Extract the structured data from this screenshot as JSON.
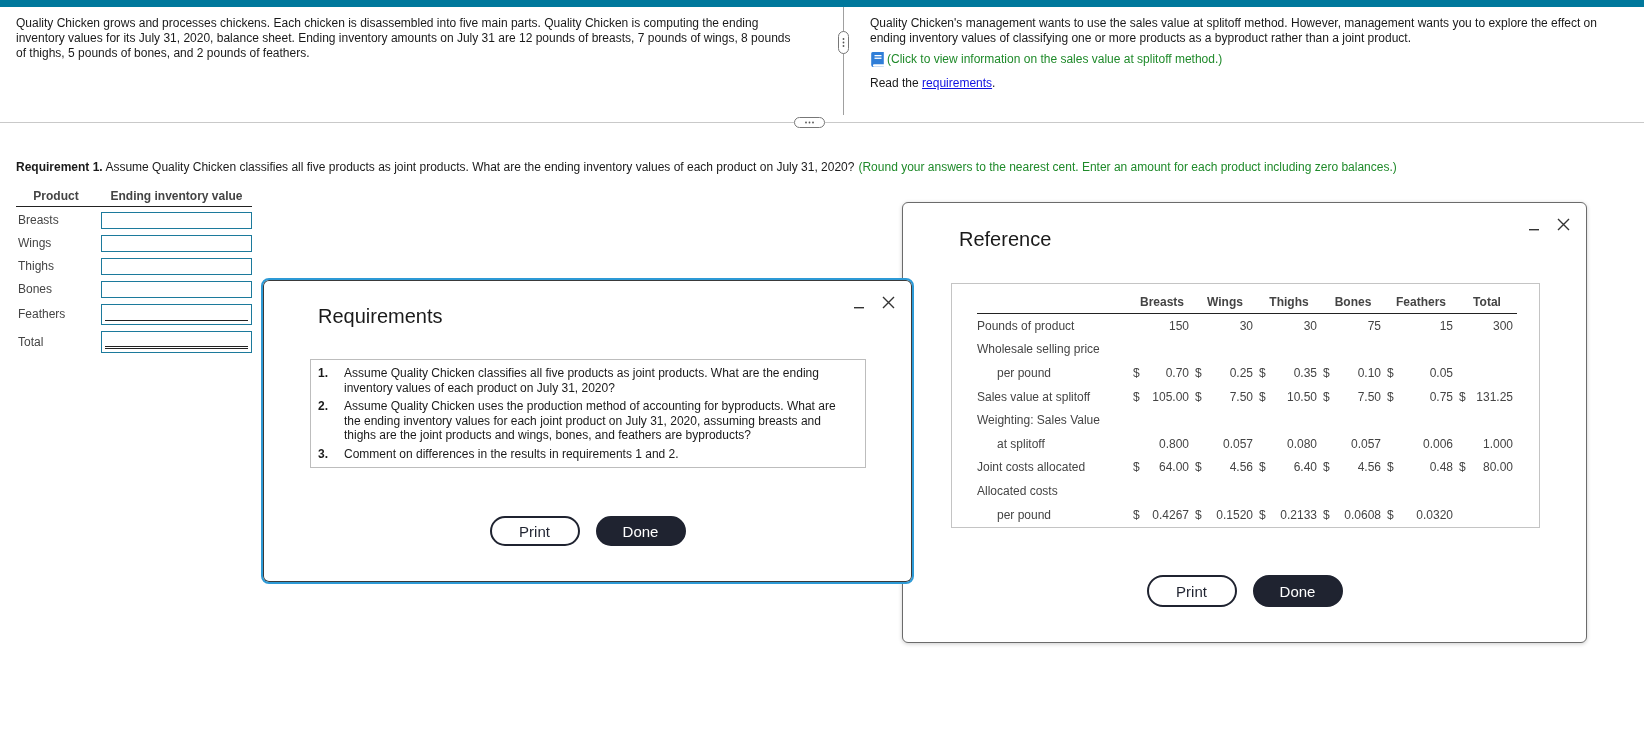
{
  "problem": {
    "text": "Quality Chicken grows and processes chickens. Each chicken is disassembled into five main parts. Quality Chicken is computing the ending inventory values for its July 31, 2020, balance sheet. Ending inventory amounts on July 31 are 12 pounds of breasts, 7 pounds of wings, 8 pounds of thighs, 5 pounds of bones, and 2 pounds of feathers."
  },
  "info": {
    "text": "Quality Chicken's management wants to use the sales value at splitoff method. However, management wants you to explore the effect on ending inventory values of classifying one or more products as a byproduct rather than a joint product.",
    "reference_link": "(Click to view information on the sales value at splitoff method.)",
    "read_before": "Read the",
    "read_link": "requirements",
    "read_after": "."
  },
  "question": {
    "text": "**Requirement 1.** Assume Quality Chicken classifies all five products as joint products. What are the ending inventory values of each product on July 31, 2020?",
    "hint": "(Round your answers to the nearest cent. Enter an amount for each product including zero balances.)"
  },
  "answer_table": {
    "columns": [
      "Product",
      "Ending inventory value"
    ],
    "rows": [
      {
        "label": "Breasts",
        "kind": "entry"
      },
      {
        "label": "Wings",
        "kind": "entry"
      },
      {
        "label": "Thighs",
        "kind": "entry"
      },
      {
        "label": "Bones",
        "kind": "entry"
      },
      {
        "label": "Feathers",
        "kind": "subtotal"
      },
      {
        "label": "Total",
        "kind": "total"
      }
    ]
  },
  "requirements_dialog": {
    "title": "Requirements",
    "focused": true,
    "items": [
      {
        "number": "1.",
        "text": "Assume Quality Chicken classifies all five products as joint products. What are the ending inventory values of each product on July 31, 2020?"
      },
      {
        "number": "2.",
        "text": "Assume Quality Chicken uses the production method of accounting for byproducts. What are the ending inventory values for each joint product on July 31, 2020, assuming breasts and thighs are the joint products and wings, bones, and feathers are byproducts?"
      },
      {
        "number": "3.",
        "text": "Comment on differences in the results in requirements 1 and 2."
      }
    ],
    "buttons": [
      {
        "label": "Print",
        "kind": "secondary"
      },
      {
        "label": "Done",
        "kind": "primary"
      }
    ]
  },
  "reference_dialog": {
    "title": "Reference",
    "focused": false,
    "table": {
      "columns": [
        "Breasts",
        "Wings",
        "Thighs",
        "Bones",
        "Feathers",
        "Total"
      ],
      "rows": [
        {
          "label": "Pounds of product",
          "cells": [
            {
              "value": "150"
            },
            {
              "value": "30"
            },
            {
              "value": "30"
            },
            {
              "value": "75"
            },
            {
              "value": "15"
            },
            {
              "value": "300"
            }
          ]
        },
        {
          "label": "Wholesale selling price",
          "continuation": "per pound",
          "cells": [
            {
              "symbol": "$",
              "value": "0.70"
            },
            {
              "symbol": "$",
              "value": "0.25"
            },
            {
              "symbol": "$",
              "value": "0.35"
            },
            {
              "symbol": "$",
              "value": "0.10"
            },
            {
              "symbol": "$",
              "value": "0.05"
            }
          ]
        },
        {
          "label": "Sales value at splitoff",
          "cells": [
            {
              "symbol": "$",
              "value": "105.00"
            },
            {
              "symbol": "$",
              "value": "7.50"
            },
            {
              "symbol": "$",
              "value": "10.50"
            },
            {
              "symbol": "$",
              "value": "7.50"
            },
            {
              "symbol": "$",
              "value": "0.75"
            },
            {
              "symbol": "$",
              "value": "131.25"
            }
          ]
        },
        {
          "label": "Weighting: Sales Value",
          "continuation": "at splitoff",
          "cells": [
            {
              "value": "0.800"
            },
            {
              "value": "0.057"
            },
            {
              "value": "0.080"
            },
            {
              "value": "0.057"
            },
            {
              "value": "0.006"
            },
            {
              "value": "1.000"
            }
          ]
        },
        {
          "label": "Joint costs allocated",
          "cells": [
            {
              "symbol": "$",
              "value": "64.00"
            },
            {
              "symbol": "$",
              "value": "4.56"
            },
            {
              "symbol": "$",
              "value": "6.40"
            },
            {
              "symbol": "$",
              "value": "4.56"
            },
            {
              "symbol": "$",
              "value": "0.48"
            },
            {
              "symbol": "$",
              "value": "80.00"
            }
          ]
        },
        {
          "label": "Allocated costs",
          "continuation": "per pound",
          "cells": [
            {
              "symbol": "$",
              "value": "0.4267"
            },
            {
              "symbol": "$",
              "value": "0.1520"
            },
            {
              "symbol": "$",
              "value": "0.2133"
            },
            {
              "symbol": "$",
              "value": "0.0608"
            },
            {
              "symbol": "$",
              "value": "0.0320"
            }
          ]
        }
      ]
    },
    "buttons": [
      {
        "label": "Print",
        "kind": "secondary"
      },
      {
        "label": "Done",
        "kind": "primary"
      }
    ]
  }
}
